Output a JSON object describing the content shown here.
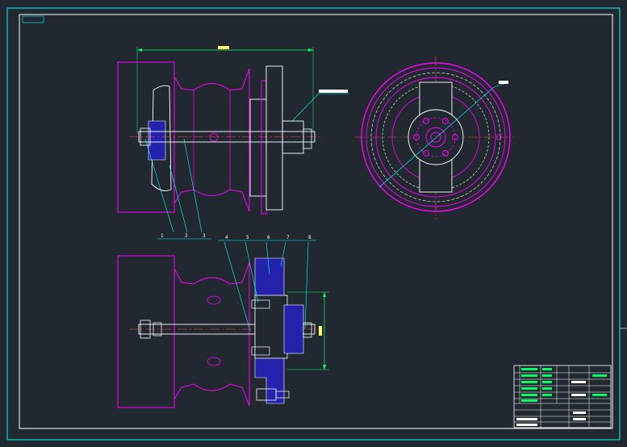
{
  "drawing": {
    "sheet_tag": "",
    "note_text": "",
    "dimensions": {
      "overall_width": "",
      "flange_height": ""
    },
    "callout_top": "",
    "callout_right": "",
    "part_numbers": [
      "1",
      "2",
      "3",
      "4",
      "5",
      "6",
      "7",
      "8"
    ],
    "title_block": {
      "title": "",
      "scale": ""
    }
  },
  "colors": {
    "background": "#212830",
    "frame": "#00ffff",
    "part_outline": "#ff00ff",
    "hidden_part": "#ffffff",
    "fill_part": "#2222aa",
    "dimension": "#00ff66",
    "leader": "#00ffff",
    "note": "#2a4bff"
  }
}
